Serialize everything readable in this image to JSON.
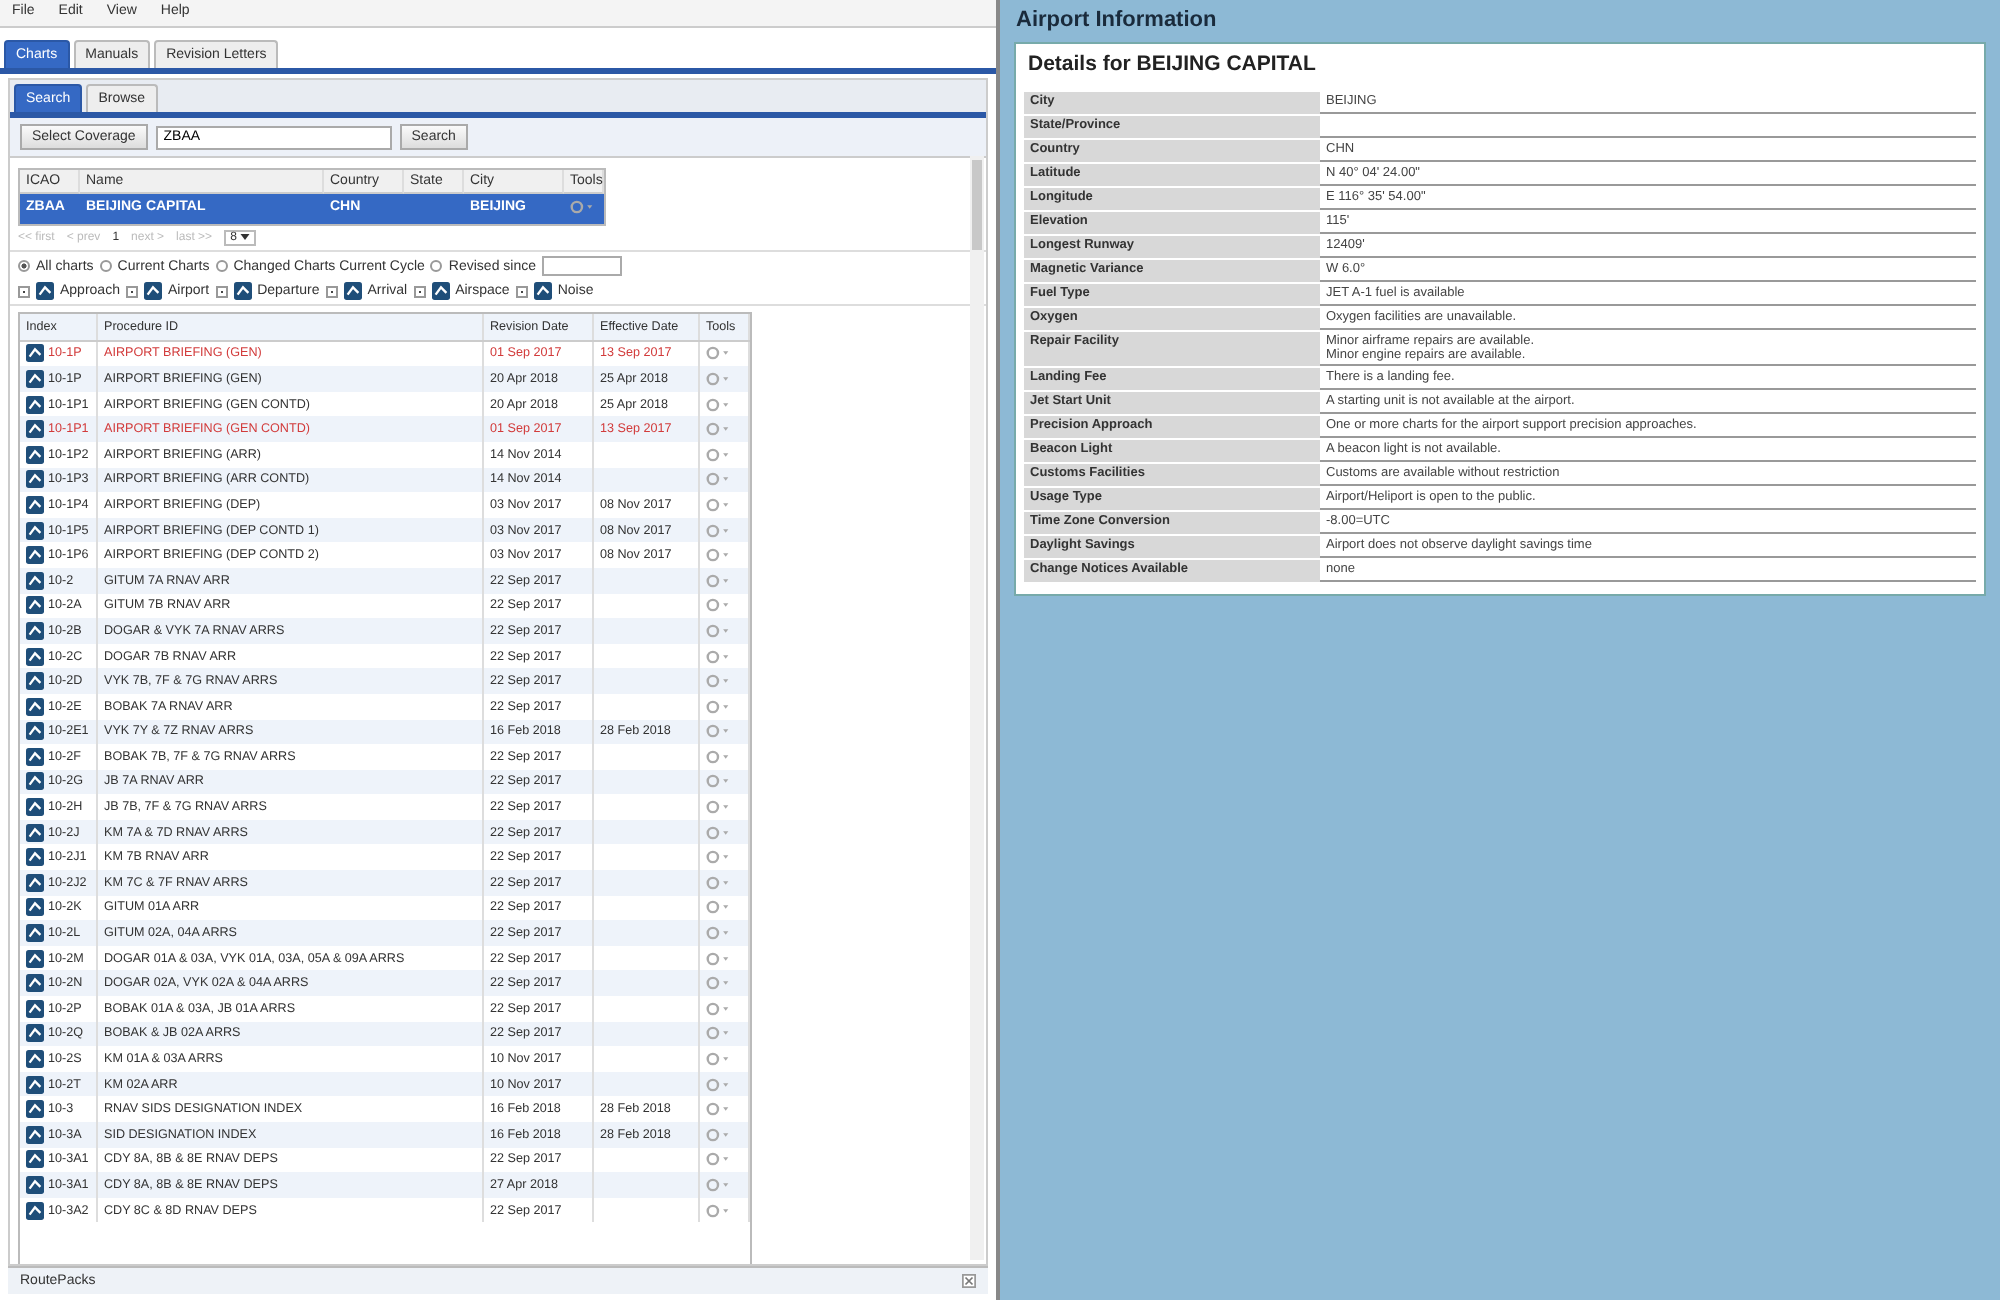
{
  "menu": [
    "File",
    "Edit",
    "View",
    "Help"
  ],
  "tabs": [
    {
      "label": "Charts",
      "selected": true
    },
    {
      "label": "Manuals",
      "selected": false
    },
    {
      "label": "Revision Letters",
      "selected": false
    }
  ],
  "subtabs": [
    {
      "label": "Search",
      "selected": true
    },
    {
      "label": "Browse",
      "selected": false
    }
  ],
  "search": {
    "coverage_button": "Select Coverage",
    "value": "ZBAA",
    "button": "Search"
  },
  "airports": {
    "columns": [
      "ICAO",
      "Name",
      "Country",
      "State",
      "City",
      "Tools"
    ],
    "rows": [
      {
        "icao": "ZBAA",
        "name": "BEIJING CAPITAL",
        "country": "CHN",
        "city": "BEIJING",
        "selected": true
      }
    ]
  },
  "pagination": {
    "first": "<< first",
    "prev": "< prev",
    "page": "1",
    "next": "next >",
    "last": "last >>",
    "page_size": "8"
  },
  "filters": {
    "radios": [
      {
        "label": "All charts",
        "selected": true
      },
      {
        "label": "Current Charts",
        "selected": false
      },
      {
        "label": "Changed Charts Current Cycle",
        "selected": false
      },
      {
        "label": "Revised since",
        "selected": false
      }
    ],
    "types": [
      {
        "label": "Approach",
        "checked": true
      },
      {
        "label": "Airport",
        "checked": true
      },
      {
        "label": "Departure",
        "checked": true
      },
      {
        "label": "Arrival",
        "checked": true
      },
      {
        "label": "Airspace",
        "checked": true
      },
      {
        "label": "Noise",
        "checked": true
      }
    ]
  },
  "charts": {
    "columns": [
      "Index",
      "Procedure ID",
      "Revision Date",
      "Effective Date",
      "Tools"
    ],
    "rows": [
      {
        "index": "10-1P",
        "procedure": "AIRPORT BRIEFING (GEN)",
        "revision": "01 Sep 2017",
        "effective": "13 Sep 2017",
        "changed": true
      },
      {
        "index": "10-1P",
        "procedure": "AIRPORT BRIEFING (GEN)",
        "revision": "20 Apr 2018",
        "effective": "25 Apr 2018",
        "changed": false
      },
      {
        "index": "10-1P1",
        "procedure": "AIRPORT BRIEFING (GEN CONTD)",
        "revision": "20 Apr 2018",
        "effective": "25 Apr 2018",
        "changed": false
      },
      {
        "index": "10-1P1",
        "procedure": "AIRPORT BRIEFING (GEN CONTD)",
        "revision": "01 Sep 2017",
        "effective": "13 Sep 2017",
        "changed": true
      },
      {
        "index": "10-1P2",
        "procedure": "AIRPORT BRIEFING (ARR)",
        "revision": "14 Nov 2014",
        "effective": "",
        "changed": false
      },
      {
        "index": "10-1P3",
        "procedure": "AIRPORT BRIEFING (ARR CONTD)",
        "revision": "14 Nov 2014",
        "effective": "",
        "changed": false
      },
      {
        "index": "10-1P4",
        "procedure": "AIRPORT BRIEFING (DEP)",
        "revision": "03 Nov 2017",
        "effective": "08 Nov 2017",
        "changed": false
      },
      {
        "index": "10-1P5",
        "procedure": "AIRPORT BRIEFING (DEP CONTD 1)",
        "revision": "03 Nov 2017",
        "effective": "08 Nov 2017",
        "changed": false
      },
      {
        "index": "10-1P6",
        "procedure": "AIRPORT BRIEFING (DEP CONTD 2)",
        "revision": "03 Nov 2017",
        "effective": "08 Nov 2017",
        "changed": false
      },
      {
        "index": "10-2",
        "procedure": "GITUM 7A RNAV ARR",
        "revision": "22 Sep 2017",
        "effective": "",
        "changed": false
      },
      {
        "index": "10-2A",
        "procedure": "GITUM 7B RNAV ARR",
        "revision": "22 Sep 2017",
        "effective": "",
        "changed": false
      },
      {
        "index": "10-2B",
        "procedure": "DOGAR & VYK 7A RNAV ARRS",
        "revision": "22 Sep 2017",
        "effective": "",
        "changed": false
      },
      {
        "index": "10-2C",
        "procedure": "DOGAR 7B RNAV ARR",
        "revision": "22 Sep 2017",
        "effective": "",
        "changed": false
      },
      {
        "index": "10-2D",
        "procedure": "VYK 7B, 7F & 7G RNAV ARRS",
        "revision": "22 Sep 2017",
        "effective": "",
        "changed": false
      },
      {
        "index": "10-2E",
        "procedure": "BOBAK 7A RNAV ARR",
        "revision": "22 Sep 2017",
        "effective": "",
        "changed": false
      },
      {
        "index": "10-2E1",
        "procedure": "VYK 7Y & 7Z RNAV ARRS",
        "revision": "16 Feb 2018",
        "effective": "28 Feb 2018",
        "changed": false
      },
      {
        "index": "10-2F",
        "procedure": "BOBAK 7B, 7F & 7G RNAV ARRS",
        "revision": "22 Sep 2017",
        "effective": "",
        "changed": false
      },
      {
        "index": "10-2G",
        "procedure": "JB 7A RNAV ARR",
        "revision": "22 Sep 2017",
        "effective": "",
        "changed": false
      },
      {
        "index": "10-2H",
        "procedure": "JB 7B, 7F & 7G RNAV ARRS",
        "revision": "22 Sep 2017",
        "effective": "",
        "changed": false
      },
      {
        "index": "10-2J",
        "procedure": "KM 7A & 7D RNAV ARRS",
        "revision": "22 Sep 2017",
        "effective": "",
        "changed": false
      },
      {
        "index": "10-2J1",
        "procedure": "KM 7B RNAV ARR",
        "revision": "22 Sep 2017",
        "effective": "",
        "changed": false
      },
      {
        "index": "10-2J2",
        "procedure": "KM 7C & 7F RNAV ARRS",
        "revision": "22 Sep 2017",
        "effective": "",
        "changed": false
      },
      {
        "index": "10-2K",
        "procedure": "GITUM 01A ARR",
        "revision": "22 Sep 2017",
        "effective": "",
        "changed": false
      },
      {
        "index": "10-2L",
        "procedure": "GITUM 02A, 04A ARRS",
        "revision": "22 Sep 2017",
        "effective": "",
        "changed": false
      },
      {
        "index": "10-2M",
        "procedure": "DOGAR 01A & 03A, VYK 01A, 03A, 05A & 09A ARRS",
        "revision": "22 Sep 2017",
        "effective": "",
        "changed": false
      },
      {
        "index": "10-2N",
        "procedure": "DOGAR 02A, VYK 02A & 04A ARRS",
        "revision": "22 Sep 2017",
        "effective": "",
        "changed": false
      },
      {
        "index": "10-2P",
        "procedure": "BOBAK 01A & 03A, JB 01A ARRS",
        "revision": "22 Sep 2017",
        "effective": "",
        "changed": false
      },
      {
        "index": "10-2Q",
        "procedure": "BOBAK & JB 02A ARRS",
        "revision": "22 Sep 2017",
        "effective": "",
        "changed": false
      },
      {
        "index": "10-2S",
        "procedure": "KM 01A & 03A ARRS",
        "revision": "10 Nov 2017",
        "effective": "",
        "changed": false
      },
      {
        "index": "10-2T",
        "procedure": "KM 02A ARR",
        "revision": "10 Nov 2017",
        "effective": "",
        "changed": false
      },
      {
        "index": "10-3",
        "procedure": "RNAV SIDS DESIGNATION INDEX",
        "revision": "16 Feb 2018",
        "effective": "28 Feb 2018",
        "changed": false
      },
      {
        "index": "10-3A",
        "procedure": "SID DESIGNATION INDEX",
        "revision": "16 Feb 2018",
        "effective": "28 Feb 2018",
        "changed": false
      },
      {
        "index": "10-3A1",
        "procedure": "CDY 8A, 8B & 8E RNAV DEPS",
        "revision": "22 Sep 2017",
        "effective": "",
        "changed": false
      },
      {
        "index": "10-3A1",
        "procedure": "CDY 8A, 8B & 8E RNAV DEPS",
        "revision": "27 Apr 2018",
        "effective": "",
        "changed": false
      },
      {
        "index": "10-3A2",
        "procedure": "CDY 8C & 8D RNAV DEPS",
        "revision": "22 Sep 2017",
        "effective": "",
        "changed": false
      }
    ]
  },
  "status_bar": {
    "label": "RoutePacks"
  },
  "info_panel": {
    "title": "Airport Information",
    "heading": "Details for BEIJING CAPITAL",
    "details": [
      {
        "label": "City",
        "value": [
          "BEIJING"
        ]
      },
      {
        "label": "State/Province"
      },
      {
        "label": "Country",
        "value": [
          "CHN"
        ]
      },
      {
        "label": "Latitude",
        "value": [
          "N 40° 04' 24.00\""
        ]
      },
      {
        "label": "Longitude",
        "value": [
          "E 116° 35' 54.00\""
        ]
      },
      {
        "label": "Elevation",
        "value": [
          "115'"
        ]
      },
      {
        "label": "Longest Runway",
        "value": [
          "12409'"
        ]
      },
      {
        "label": "Magnetic Variance",
        "value": [
          "W 6.0°"
        ]
      },
      {
        "label": "Fuel Type",
        "value": [
          "JET A-1 fuel is available"
        ]
      },
      {
        "label": "Oxygen",
        "value": [
          "Oxygen facilities are unavailable."
        ]
      },
      {
        "label": "Repair Facility",
        "value": [
          "Minor airframe repairs are available.",
          "Minor engine repairs are available."
        ]
      },
      {
        "label": "Landing Fee",
        "value": [
          "There is a landing fee."
        ]
      },
      {
        "label": "Jet Start Unit",
        "value": [
          "A starting unit is not available at the airport."
        ]
      },
      {
        "label": "Precision Approach",
        "value": [
          "One or more charts for the airport support precision approaches."
        ]
      },
      {
        "label": "Beacon Light",
        "value": [
          "A beacon light is not available."
        ]
      },
      {
        "label": "Customs Facilities",
        "value": [
          "Customs are available without restriction"
        ]
      },
      {
        "label": "Usage Type",
        "value": [
          "Airport/Heliport is open to the public."
        ]
      },
      {
        "label": "Time Zone Conversion",
        "value": [
          "-8.00=UTC"
        ]
      },
      {
        "label": "Daylight Savings",
        "value": [
          "Airport does not observe daylight savings time"
        ]
      },
      {
        "label": "Change Notices Available",
        "value": [
          "none"
        ]
      }
    ]
  }
}
